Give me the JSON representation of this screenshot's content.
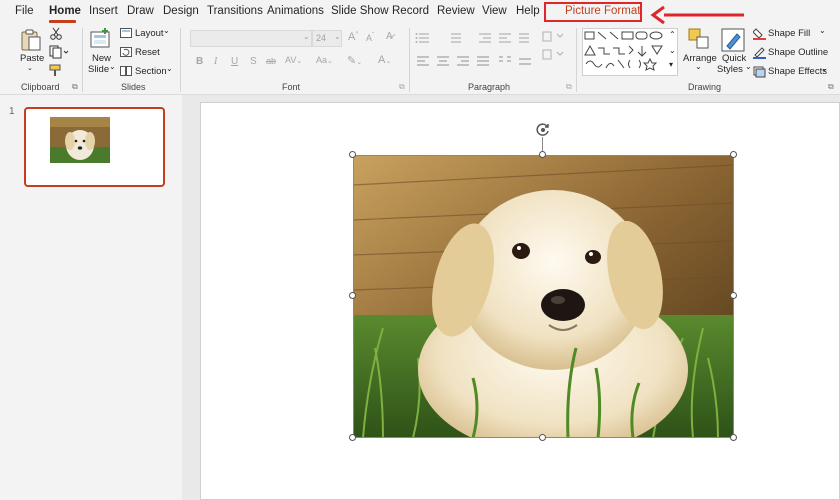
{
  "tabs": [
    {
      "label": "File",
      "active": false
    },
    {
      "label": "Home",
      "active": true
    },
    {
      "label": "Insert",
      "active": false
    },
    {
      "label": "Draw",
      "active": false
    },
    {
      "label": "Design",
      "active": false
    },
    {
      "label": "Transitions",
      "active": false
    },
    {
      "label": "Animations",
      "active": false
    },
    {
      "label": "Slide Show",
      "active": false
    },
    {
      "label": "Record",
      "active": false
    },
    {
      "label": "Review",
      "active": false
    },
    {
      "label": "View",
      "active": false
    },
    {
      "label": "Help",
      "active": false
    }
  ],
  "contextual_tab": {
    "label": "Picture Format",
    "highlight_color": "#e0262a"
  },
  "ribbon": {
    "clipboard": {
      "paste": "Paste",
      "group": "Clipboard"
    },
    "slides": {
      "new_slide_1": "New",
      "new_slide_2": "Slide",
      "layout": "Layout",
      "reset": "Reset",
      "section": "Section",
      "group": "Slides"
    },
    "font": {
      "font_name": "",
      "font_size": "24",
      "group": "Font"
    },
    "paragraph": {
      "group": "Paragraph"
    },
    "drawing": {
      "arrange": "Arrange",
      "quick_styles_1": "Quick",
      "quick_styles_2": "Styles",
      "shape_fill": "Shape Fill",
      "shape_outline": "Shape Outline",
      "shape_effects": "Shape Effects",
      "group": "Drawing"
    }
  },
  "slide_panel": {
    "slide_number": "1"
  },
  "accent_color": "#c43e1c"
}
